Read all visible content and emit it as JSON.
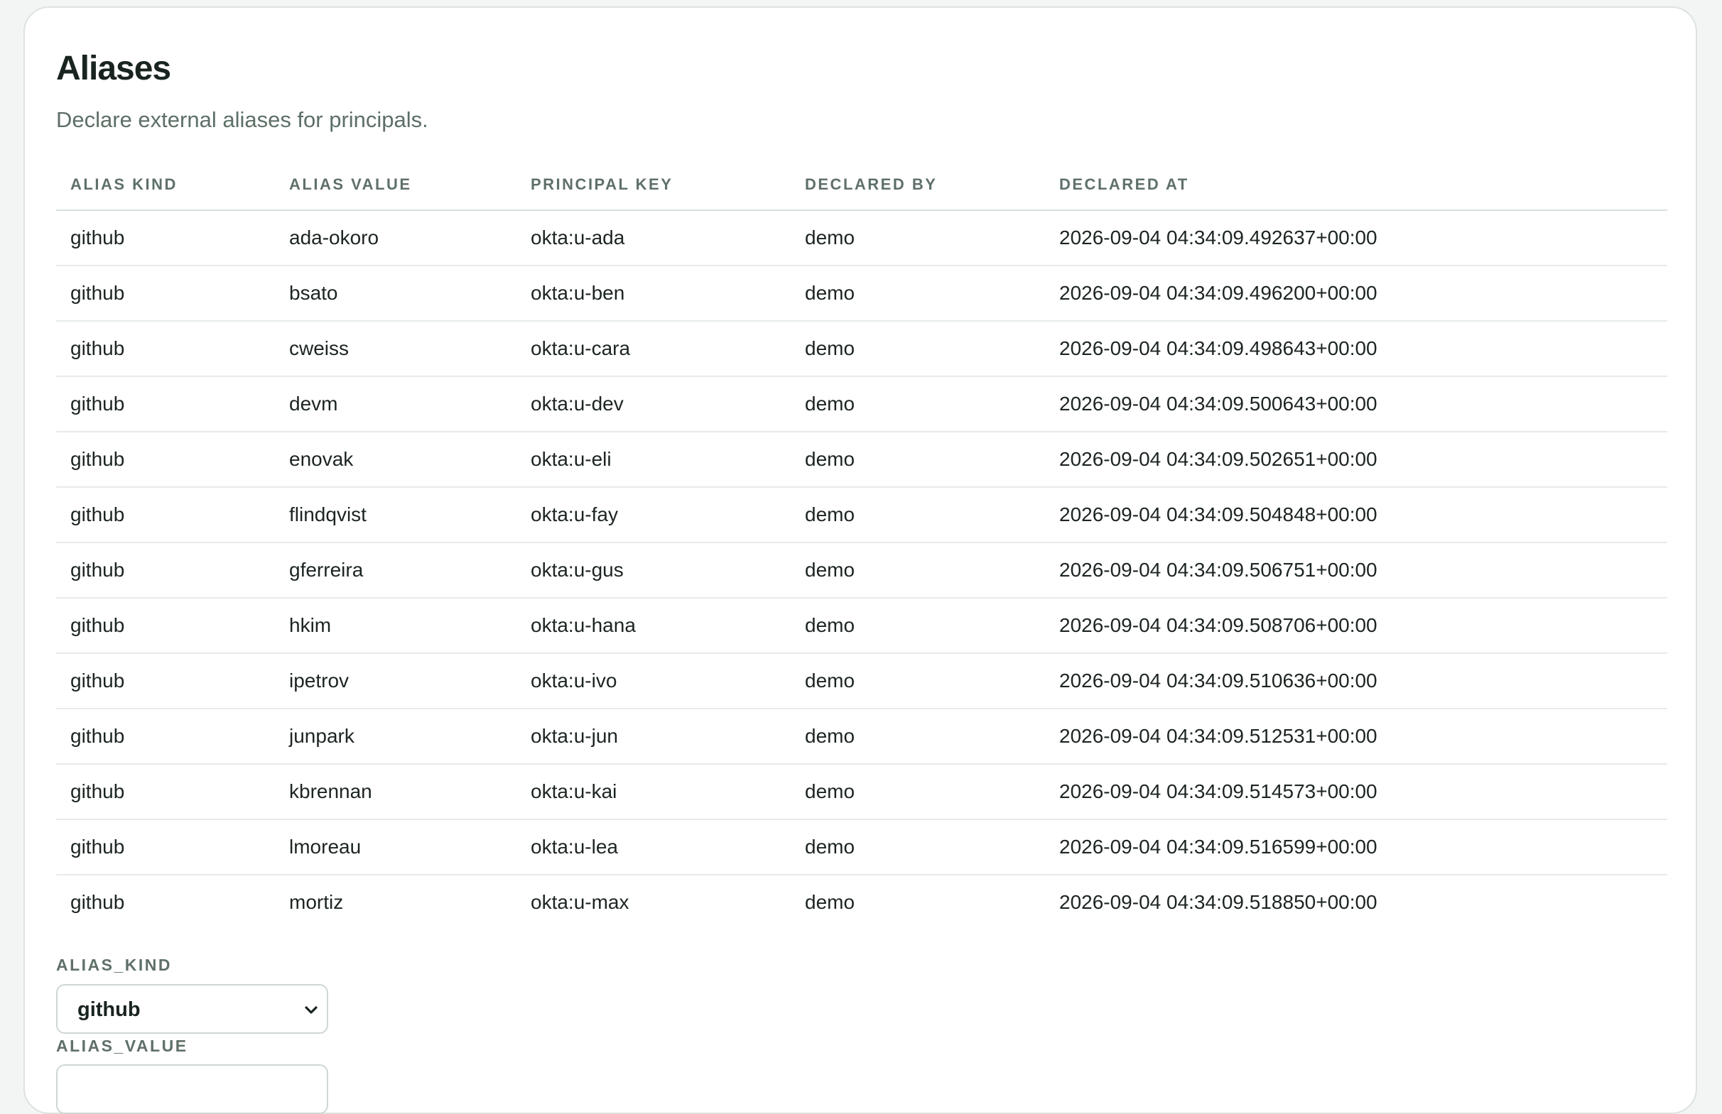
{
  "page": {
    "title": "Aliases",
    "subtitle": "Declare external aliases for principals."
  },
  "table": {
    "columns": [
      "Alias Kind",
      "Alias Value",
      "Principal Key",
      "Declared By",
      "Declared At"
    ],
    "rows": [
      [
        "github",
        "ada-okoro",
        "okta:u-ada",
        "demo",
        "2026-09-04 04:34:09.492637+00:00"
      ],
      [
        "github",
        "bsato",
        "okta:u-ben",
        "demo",
        "2026-09-04 04:34:09.496200+00:00"
      ],
      [
        "github",
        "cweiss",
        "okta:u-cara",
        "demo",
        "2026-09-04 04:34:09.498643+00:00"
      ],
      [
        "github",
        "devm",
        "okta:u-dev",
        "demo",
        "2026-09-04 04:34:09.500643+00:00"
      ],
      [
        "github",
        "enovak",
        "okta:u-eli",
        "demo",
        "2026-09-04 04:34:09.502651+00:00"
      ],
      [
        "github",
        "flindqvist",
        "okta:u-fay",
        "demo",
        "2026-09-04 04:34:09.504848+00:00"
      ],
      [
        "github",
        "gferreira",
        "okta:u-gus",
        "demo",
        "2026-09-04 04:34:09.506751+00:00"
      ],
      [
        "github",
        "hkim",
        "okta:u-hana",
        "demo",
        "2026-09-04 04:34:09.508706+00:00"
      ],
      [
        "github",
        "ipetrov",
        "okta:u-ivo",
        "demo",
        "2026-09-04 04:34:09.510636+00:00"
      ],
      [
        "github",
        "junpark",
        "okta:u-jun",
        "demo",
        "2026-09-04 04:34:09.512531+00:00"
      ],
      [
        "github",
        "kbrennan",
        "okta:u-kai",
        "demo",
        "2026-09-04 04:34:09.514573+00:00"
      ],
      [
        "github",
        "lmoreau",
        "okta:u-lea",
        "demo",
        "2026-09-04 04:34:09.516599+00:00"
      ],
      [
        "github",
        "mortiz",
        "okta:u-max",
        "demo",
        "2026-09-04 04:34:09.518850+00:00"
      ]
    ]
  },
  "form": {
    "alias_kind_label": "ALIAS_KIND",
    "alias_kind_value": "github",
    "alias_value_label": "ALIAS_VALUE",
    "alias_value_value": ""
  },
  "icons": {
    "select_chevron": "chevron-down-icon"
  }
}
